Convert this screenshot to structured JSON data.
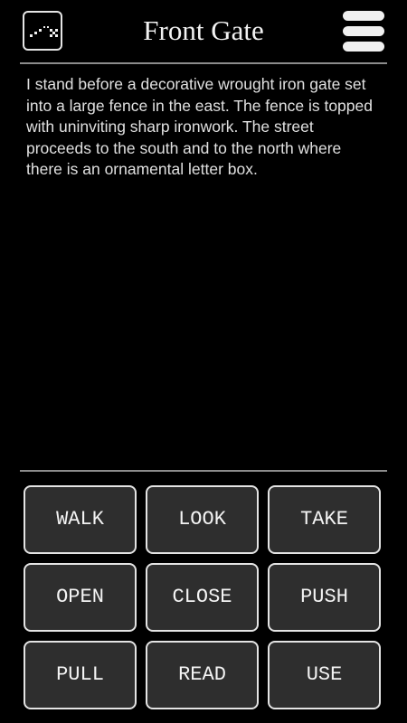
{
  "header": {
    "title": "Front Gate",
    "map_icon": "map-icon",
    "menu_icon": "hamburger-menu-icon"
  },
  "description": "I stand before a decorative wrought iron gate set into a large fence in the east. The fence is topped with uninviting sharp ironwork. The street proceeds to the south and to the north where there is an ornamental letter box.",
  "verbs": [
    "WALK",
    "LOOK",
    "TAKE",
    "OPEN",
    "CLOSE",
    "PUSH",
    "PULL",
    "READ",
    "USE"
  ],
  "colors": {
    "background": "#000000",
    "text": "#e0e0e0",
    "button_fill": "#2e2e2e",
    "button_border": "#e4e4e4",
    "divider": "#8c8c8c"
  }
}
